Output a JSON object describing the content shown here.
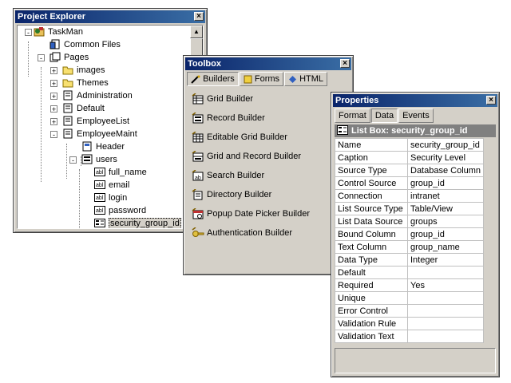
{
  "explorer": {
    "title": "Project Explorer",
    "close_label": "×",
    "items": [
      {
        "label": "TaskMan",
        "icon": "project-icon",
        "expand": "-"
      },
      {
        "label": "Common Files",
        "icon": "common-files-icon"
      },
      {
        "label": "Pages",
        "icon": "pages-icon",
        "expand": "-"
      },
      {
        "label": "images",
        "icon": "folder-icon",
        "expand": "+"
      },
      {
        "label": "Themes",
        "icon": "folder-icon",
        "expand": "+"
      },
      {
        "label": "Administration",
        "icon": "page-icon",
        "expand": "+"
      },
      {
        "label": "Default",
        "icon": "page-icon",
        "expand": "+"
      },
      {
        "label": "EmployeeList",
        "icon": "page-icon",
        "expand": "+"
      },
      {
        "label": "EmployeeMaint",
        "icon": "page-icon",
        "expand": "-"
      },
      {
        "label": "Header",
        "icon": "include-icon"
      },
      {
        "label": "users",
        "icon": "form-icon",
        "expand": "-"
      },
      {
        "label": "full_name",
        "icon": "textbox-icon"
      },
      {
        "label": "email",
        "icon": "textbox-icon"
      },
      {
        "label": "login",
        "icon": "textbox-icon"
      },
      {
        "label": "password",
        "icon": "textbox-icon"
      },
      {
        "label": "security_group_id",
        "icon": "listbox-icon"
      }
    ]
  },
  "toolbox": {
    "title": "Toolbox",
    "close_label": "×",
    "tabs": [
      {
        "label": "Builders",
        "icon": "wand-icon",
        "active": true
      },
      {
        "label": "Forms",
        "icon": "forms-icon"
      },
      {
        "label": "HTML",
        "icon": "html-icon"
      }
    ],
    "items": [
      {
        "label": "Grid Builder",
        "icon": "grid-builder-icon"
      },
      {
        "label": "Record Builder",
        "icon": "record-builder-icon"
      },
      {
        "label": "Editable Grid Builder",
        "icon": "editable-grid-builder-icon"
      },
      {
        "label": "Grid and Record Builder",
        "icon": "grid-record-builder-icon"
      },
      {
        "label": "Search Builder",
        "icon": "search-builder-icon"
      },
      {
        "label": "Directory Builder",
        "icon": "directory-builder-icon"
      },
      {
        "label": "Popup Date Picker Builder",
        "icon": "date-picker-builder-icon"
      },
      {
        "label": "Authentication Builder",
        "icon": "authentication-builder-icon"
      }
    ]
  },
  "properties": {
    "title": "Properties",
    "close_label": "×",
    "tabs": [
      {
        "label": "Format"
      },
      {
        "label": "Data",
        "active": true
      },
      {
        "label": "Events"
      }
    ],
    "header": "List Box: security_group_id",
    "rows": [
      {
        "key": "Name",
        "value": "security_group_id"
      },
      {
        "key": "Caption",
        "value": "Security Level"
      },
      {
        "key": "Source Type",
        "value": "Database Column"
      },
      {
        "key": "Control Source",
        "value": "group_id"
      },
      {
        "key": "Connection",
        "value": "intranet"
      },
      {
        "key": "List Source Type",
        "value": "Table/View"
      },
      {
        "key": "List Data Source",
        "value": "groups"
      },
      {
        "key": "Bound Column",
        "value": "group_id"
      },
      {
        "key": "Text Column",
        "value": "group_name"
      },
      {
        "key": "Data Type",
        "value": "Integer"
      },
      {
        "key": "Default",
        "value": ""
      },
      {
        "key": "Required",
        "value": "Yes"
      },
      {
        "key": "Unique",
        "value": ""
      },
      {
        "key": "Error Control",
        "value": ""
      },
      {
        "key": "Validation Rule",
        "value": ""
      },
      {
        "key": "Validation Text",
        "value": ""
      }
    ]
  },
  "colors": {
    "titlebar_start": "#0a246a",
    "titlebar_end": "#3a6ea5",
    "chrome": "#d4d0c8",
    "header_bar": "#808080"
  }
}
